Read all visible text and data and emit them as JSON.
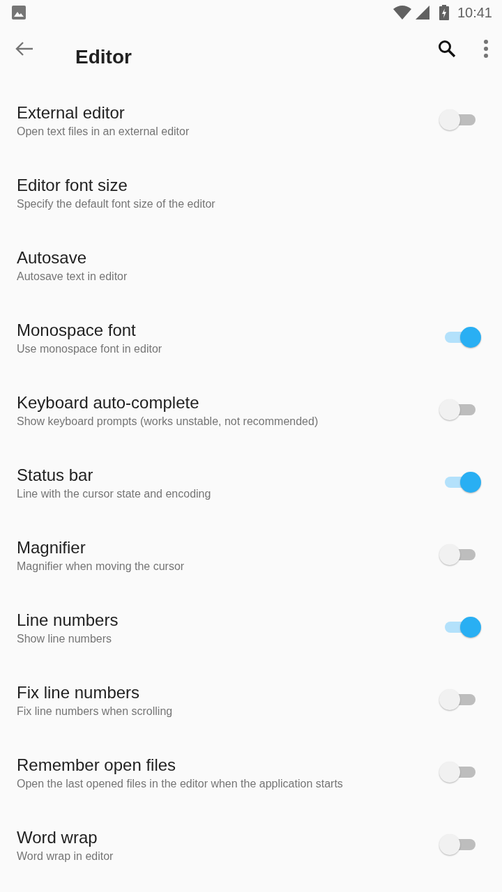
{
  "status_bar": {
    "time": "10:41"
  },
  "toolbar": {
    "title": "Editor"
  },
  "settings": [
    {
      "kind": "switch",
      "title": "External editor",
      "subtitle": "Open text files in an external editor",
      "on": false
    },
    {
      "kind": "link",
      "title": "Editor font size",
      "subtitle": "Specify the default font size of the editor"
    },
    {
      "kind": "link",
      "title": "Autosave",
      "subtitle": "Autosave text in editor"
    },
    {
      "kind": "switch",
      "title": "Monospace font",
      "subtitle": "Use monospace font in editor",
      "on": true
    },
    {
      "kind": "switch",
      "title": "Keyboard auto-complete",
      "subtitle": "Show keyboard prompts (works unstable, not recommended)",
      "on": false
    },
    {
      "kind": "switch",
      "title": "Status bar",
      "subtitle": "Line with the cursor state and encoding",
      "on": true
    },
    {
      "kind": "switch",
      "title": "Magnifier",
      "subtitle": "Magnifier when moving the cursor",
      "on": false
    },
    {
      "kind": "switch",
      "title": "Line numbers",
      "subtitle": "Show line numbers",
      "on": true
    },
    {
      "kind": "switch",
      "title": "Fix line numbers",
      "subtitle": "Fix line numbers when scrolling",
      "on": false
    },
    {
      "kind": "switch",
      "title": "Remember open files",
      "subtitle": "Open the last opened files in the editor when the application starts",
      "on": false
    },
    {
      "kind": "switch",
      "title": "Word wrap",
      "subtitle": "Word wrap in editor",
      "on": false
    }
  ]
}
